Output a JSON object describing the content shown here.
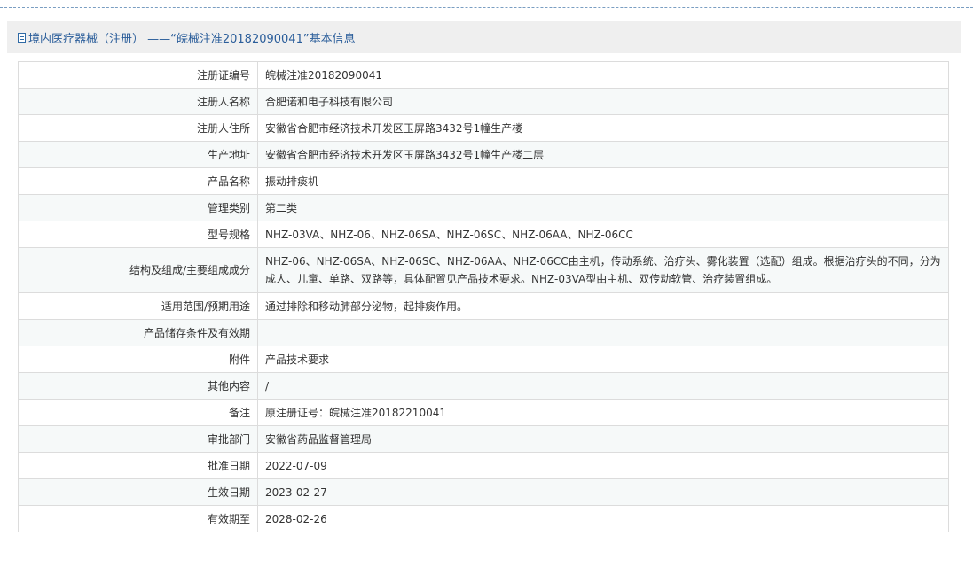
{
  "header": {
    "title": "境内医疗器械（注册） ——“皖械注准20182090041”基本信息",
    "icon": "document-icon"
  },
  "rows": [
    {
      "label": "注册证编号",
      "value": "皖械注准20182090041"
    },
    {
      "label": "注册人名称",
      "value": "合肥诺和电子科技有限公司"
    },
    {
      "label": "注册人住所",
      "value": "安徽省合肥市经济技术开发区玉屏路3432号1幢生产楼"
    },
    {
      "label": "生产地址",
      "value": "安徽省合肥市经济技术开发区玉屏路3432号1幢生产楼二层"
    },
    {
      "label": "产品名称",
      "value": "振动排痰机"
    },
    {
      "label": "管理类别",
      "value": "第二类"
    },
    {
      "label": "型号规格",
      "value": "NHZ-03VA、NHZ-06、NHZ-06SA、NHZ-06SC、NHZ-06AA、NHZ-06CC"
    },
    {
      "label": "结构及组成/主要组成成分",
      "value": "NHZ-06、NHZ-06SA、NHZ-06SC、NHZ-06AA、NHZ-06CC由主机，传动系统、治疗头、雾化装置（选配）组成。根据治疗头的不同，分为成人、儿童、单路、双路等，具体配置见产品技术要求。NHZ-03VA型由主机、双传动软管、治疗装置组成。"
    },
    {
      "label": "适用范围/预期用途",
      "value": "通过排除和移动肺部分泌物，起排痰作用。"
    },
    {
      "label": "产品储存条件及有效期",
      "value": ""
    },
    {
      "label": "附件",
      "value": "产品技术要求"
    },
    {
      "label": "其他内容",
      "value": "/"
    },
    {
      "label": "备注",
      "value": "原注册证号：皖械注准20182210041"
    },
    {
      "label": "审批部门",
      "value": "安徽省药品监督管理局"
    },
    {
      "label": "批准日期",
      "value": "2022-07-09"
    },
    {
      "label": "生效日期",
      "value": "2023-02-27"
    },
    {
      "label": "有效期至",
      "value": "2028-02-26"
    }
  ],
  "colors": {
    "title": "#2a5d9a",
    "border": "#dcdcdc",
    "stripe": "#f6f9f9"
  }
}
